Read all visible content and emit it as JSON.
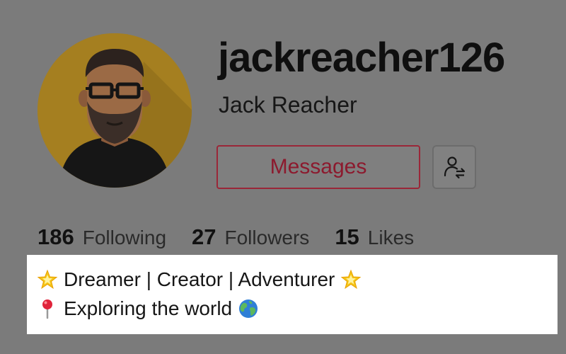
{
  "profile": {
    "username": "jackreacher126",
    "display_name": "Jack Reacher",
    "avatar_icon": "bearded-man-with-glasses-avatar"
  },
  "actions": {
    "messages_label": "Messages",
    "friend_icon": "person-swap-icon"
  },
  "stats": [
    {
      "count": "186",
      "label": "Following"
    },
    {
      "count": "27",
      "label": "Followers"
    },
    {
      "count": "15",
      "label": "Likes"
    }
  ],
  "bio": {
    "line1": "Dreamer | Creator | Adventurer",
    "line1_icons": [
      "star-icon",
      "star-icon"
    ],
    "line2": "Exploring the world",
    "line2_icons": [
      "pin-icon",
      "globe-icon"
    ]
  },
  "colors": {
    "messages_accent": "#8c1a2e",
    "avatar_bg": "#a57f20"
  }
}
